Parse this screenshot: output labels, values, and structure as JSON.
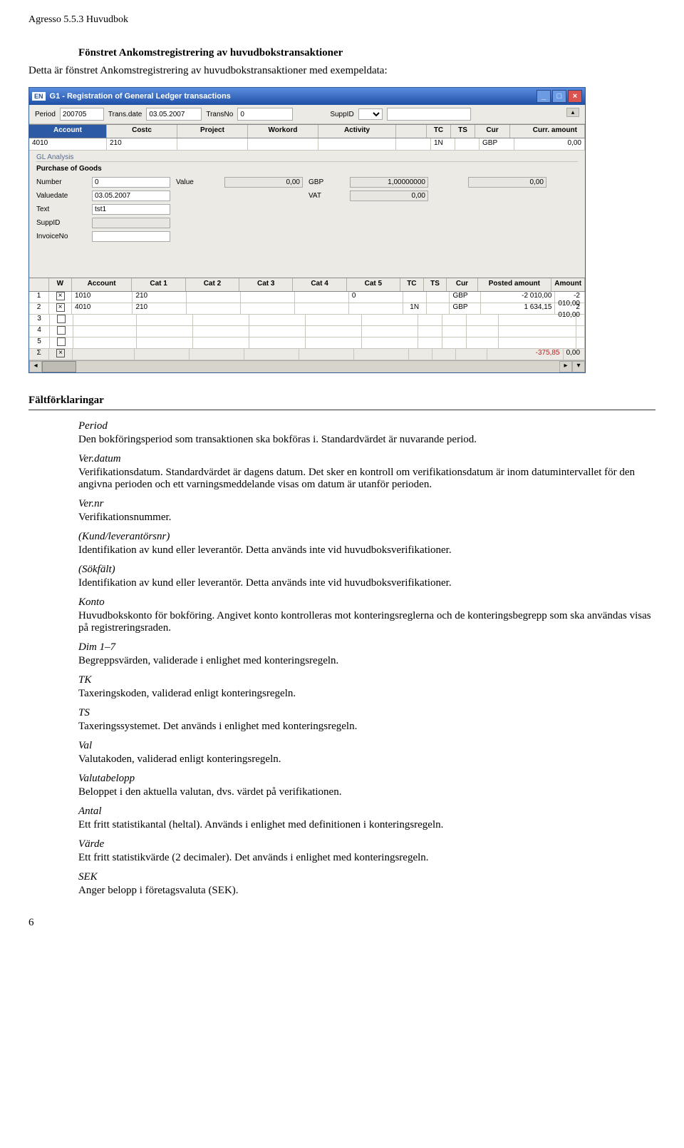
{
  "doc": {
    "header": "Agresso 5.5.3 Huvudbok",
    "section_title": "Fönstret Ankomstregistrering av huvudbokstransaktioner",
    "intro": "Detta är fönstret Ankomstregistrering av huvudbokstransaktioner med exempeldata:",
    "field_heading": "Fältförklaringar",
    "page_number": "6"
  },
  "app": {
    "en_badge": "EN",
    "title": "G1 - Registration of General Ledger transactions",
    "toolbar": {
      "period_label": "Period",
      "period_value": "200705",
      "transdate_label": "Trans.date",
      "transdate_value": "03.05.2007",
      "transno_label": "TransNo",
      "transno_value": "0",
      "suppid_label": "SuppID",
      "suppid_value": ""
    },
    "grid1": {
      "headers": {
        "account": "Account",
        "costc": "Costc",
        "project": "Project",
        "workord": "Workord",
        "activity": "Activity",
        "tc": "TC",
        "ts": "TS",
        "cur": "Cur",
        "amt": "Curr. amount"
      },
      "row": {
        "account": "4010",
        "costc": "210",
        "tc": "1N",
        "ts": "",
        "cur": "GBP",
        "amt": "0,00"
      }
    },
    "gl": {
      "label": "GL Analysis",
      "subtitle": "Purchase of Goods"
    },
    "form": {
      "number_label": "Number",
      "number_value": "0",
      "value_label": "Value",
      "value_value": "0,00",
      "gbp_label": "GBP",
      "gbp_value": "1,00000000",
      "gbp_right": "0,00",
      "valuedate_label": "Valuedate",
      "valuedate_value": "03.05.2007",
      "vat_label": "VAT",
      "vat_value": "0,00",
      "text_label": "Text",
      "text_value": "tst1",
      "suppid_label": "SuppID",
      "suppid_value": "",
      "invoiceno_label": "InvoiceNo",
      "invoiceno_value": ""
    },
    "grid2": {
      "headers": {
        "num": "",
        "w": "W",
        "account": "Account",
        "cat1": "Cat 1",
        "cat2": "Cat 2",
        "cat3": "Cat 3",
        "cat4": "Cat 4",
        "cat5": "Cat 5",
        "tc": "TC",
        "ts": "TS",
        "cur": "Cur",
        "posted": "Posted amount",
        "amt": "Amount"
      },
      "rows": [
        {
          "num": "1",
          "w": true,
          "account": "1010",
          "cat1": "210",
          "cat5": "0",
          "tc": "",
          "ts": "",
          "cur": "GBP",
          "posted": "-2 010,00",
          "amt": "-2 010,00"
        },
        {
          "num": "2",
          "w": true,
          "account": "4010",
          "cat1": "210",
          "cat5": "",
          "tc": "1N",
          "ts": "",
          "cur": "GBP",
          "posted": "1 634,15",
          "amt": "2 010,00"
        },
        {
          "num": "3",
          "w": false
        },
        {
          "num": "4",
          "w": false
        },
        {
          "num": "5",
          "w": false
        }
      ],
      "sum": {
        "symbol": "Σ",
        "w": true,
        "posted": "-375,85",
        "amt": "0,00"
      }
    }
  },
  "fields": [
    {
      "term": "Period",
      "desc": "Den bokföringsperiod som transaktionen ska bokföras i. Standardvärdet är nuvarande period."
    },
    {
      "term": "Ver.datum",
      "desc": "Verifikationsdatum. Standardvärdet är dagens datum. Det sker en kontroll om verifikationsdatum är inom datumintervallet för den angivna perioden och ett varningsmeddelande visas om datum är utanför perioden."
    },
    {
      "term": "Ver.nr",
      "desc": "Verifikationsnummer."
    },
    {
      "term": "(Kund/leverantörsnr)",
      "desc": "Identifikation av kund eller leverantör. Detta används inte vid huvudboksverifikationer."
    },
    {
      "term": "(Sökfält)",
      "desc": "Identifikation av kund eller leverantör. Detta används inte vid huvudboksverifikationer."
    },
    {
      "term": "Konto",
      "desc": "Huvudbokskonto för bokföring. Angivet konto kontrolleras mot konteringsreglerna och de konteringsbegrepp som ska användas visas på registreringsraden."
    },
    {
      "term": "Dim 1–7",
      "desc": "Begreppsvärden, validerade i enlighet med konteringsregeln."
    },
    {
      "term": "TK",
      "desc": "Taxeringskoden, validerad enligt konteringsregeln."
    },
    {
      "term": "TS",
      "desc": "Taxeringssystemet. Det används i enlighet med konteringsregeln."
    },
    {
      "term": "Val",
      "desc": "Valutakoden, validerad enligt konteringsregeln."
    },
    {
      "term": "Valutabelopp",
      "desc": "Beloppet i den aktuella valutan, dvs. värdet på verifikationen."
    },
    {
      "term": "Antal",
      "desc": "Ett fritt statistikantal (heltal). Används i enlighet med definitionen i konteringsregeln."
    },
    {
      "term": "Värde",
      "desc": "Ett fritt statistikvärde (2 decimaler). Det används i enlighet med konteringsregeln."
    },
    {
      "term": "SEK",
      "desc": "Anger belopp i företagsvaluta (SEK)."
    }
  ]
}
